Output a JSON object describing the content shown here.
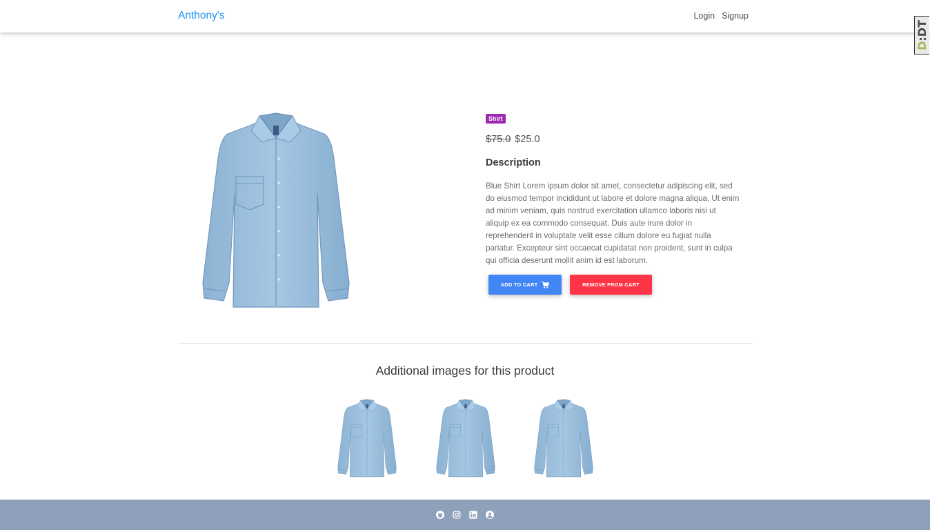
{
  "navbar": {
    "brand": "Anthony's",
    "links": [
      "Login",
      "Signup"
    ]
  },
  "side_tab": {
    "prefix": "D",
    "rest": ":DT"
  },
  "product": {
    "category": "Shirt",
    "old_price": "$75.0",
    "price": "$25.0",
    "description_title": "Description",
    "description": "Blue Shirt Lorem ipsum dolor sit amet, consectetur adipiscing elit, sed do eiusmod tempor incididunt ut labore et dolore magna aliqua. Ut enim ad minim veniam, quis nostrud exercitation ullamco laboris nisi ut aliquip ex ea commodo consequat. Duis aute irure dolor in reprehenderit in voluptate velit esse cillum dolore eu fugiat nulla pariatur. Excepteur sint occaecat cupidatat non proident, sunt in culpa qui officia deserunt mollit anim id est laborum.",
    "add_to_cart_label": "ADD TO CART",
    "remove_from_cart_label": "REMOVE FROM CART"
  },
  "additional": {
    "title": "Additional images for this product"
  },
  "icons": {
    "cart": "cart-icon",
    "footer": [
      "github-icon",
      "instagram-icon",
      "linkedin-icon",
      "user-circle-icon"
    ]
  },
  "colors": {
    "brand": "#2196f3",
    "badge": "#9c27b0",
    "add_button": "#4285f4",
    "remove_button": "#ff3547",
    "footer": "#8fa0bb",
    "shirt": "#8fb6d6"
  }
}
